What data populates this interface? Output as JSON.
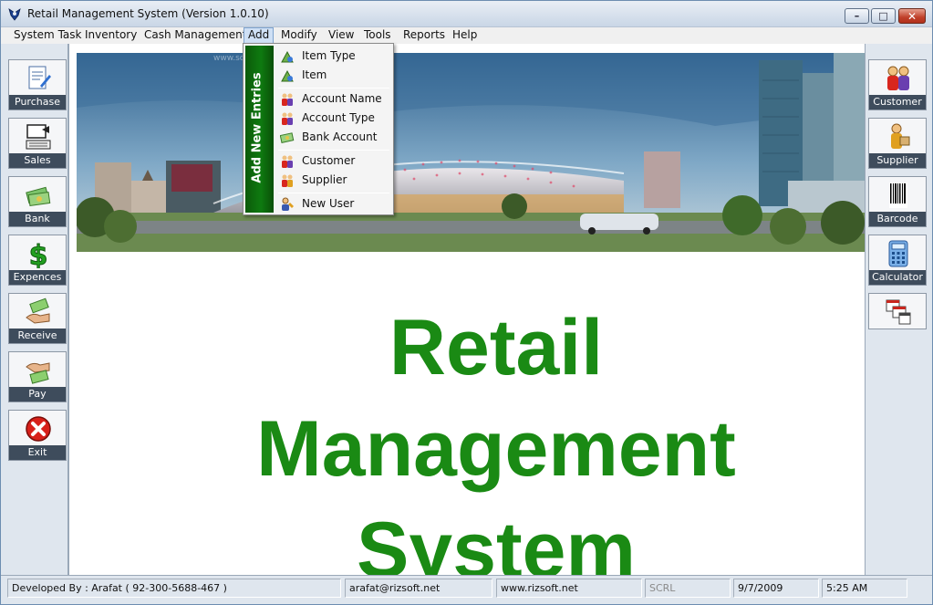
{
  "window": {
    "title": "Retail Management System (Version 1.0.10)",
    "controls": {
      "minimize": "–",
      "maximize": "□",
      "close": "✕"
    }
  },
  "menubar": {
    "items": [
      {
        "label": "System Task"
      },
      {
        "label": "Inventory"
      },
      {
        "label": "Cash Management"
      },
      {
        "label": "Add"
      },
      {
        "label": "Modify"
      },
      {
        "label": "View"
      },
      {
        "label": "Tools"
      },
      {
        "label": "Reports"
      },
      {
        "label": "Help"
      }
    ],
    "active": "Add"
  },
  "add_menu": {
    "side_title": "Add New Entries",
    "items": [
      {
        "label": "Item Type",
        "icon": "item-type-icon"
      },
      {
        "label": "Item",
        "icon": "item-icon"
      },
      {
        "label": "Account Name",
        "icon": "account-name-icon"
      },
      {
        "label": "Account Type",
        "icon": "account-type-icon"
      },
      {
        "label": "Bank Account",
        "icon": "bank-account-icon"
      },
      {
        "label": "Customer",
        "icon": "customer-icon"
      },
      {
        "label": "Supplier",
        "icon": "supplier-icon"
      },
      {
        "label": "New User",
        "icon": "new-user-icon"
      }
    ]
  },
  "left_toolbar": [
    {
      "label": "Purchase",
      "icon": "purchase-icon"
    },
    {
      "label": "Sales",
      "icon": "sales-icon"
    },
    {
      "label": "Bank",
      "icon": "bank-icon"
    },
    {
      "label": "Expences",
      "icon": "expences-icon"
    },
    {
      "label": "Receive",
      "icon": "receive-icon"
    },
    {
      "label": "Pay",
      "icon": "pay-icon"
    },
    {
      "label": "Exit",
      "icon": "exit-icon"
    }
  ],
  "right_toolbar": [
    {
      "label": "Customer",
      "icon": "customer-icon"
    },
    {
      "label": "Supplier",
      "icon": "supplier-icon"
    },
    {
      "label": "Barcode",
      "icon": "barcode-icon"
    },
    {
      "label": "Calculator",
      "icon": "calculator-icon"
    },
    {
      "label": "",
      "icon": "windows-icon"
    }
  ],
  "main": {
    "watermark": "www.softpedia.com",
    "brand_lines": [
      "Retail",
      "Management",
      "System"
    ]
  },
  "statusbar": {
    "developer": "Developed By : Arafat ( 92-300-5688-467 )",
    "email": "arafat@rizsoft.net",
    "website": "www.rizsoft.net",
    "scrl": "SCRL",
    "date": "9/7/2009",
    "time": "5:25 AM"
  },
  "colors": {
    "brand_green": "#1a8a14",
    "menu_side_green": "#0e7a10",
    "toolbar_label_bg": "#3e4c5c",
    "close_red": "#c0402a"
  }
}
